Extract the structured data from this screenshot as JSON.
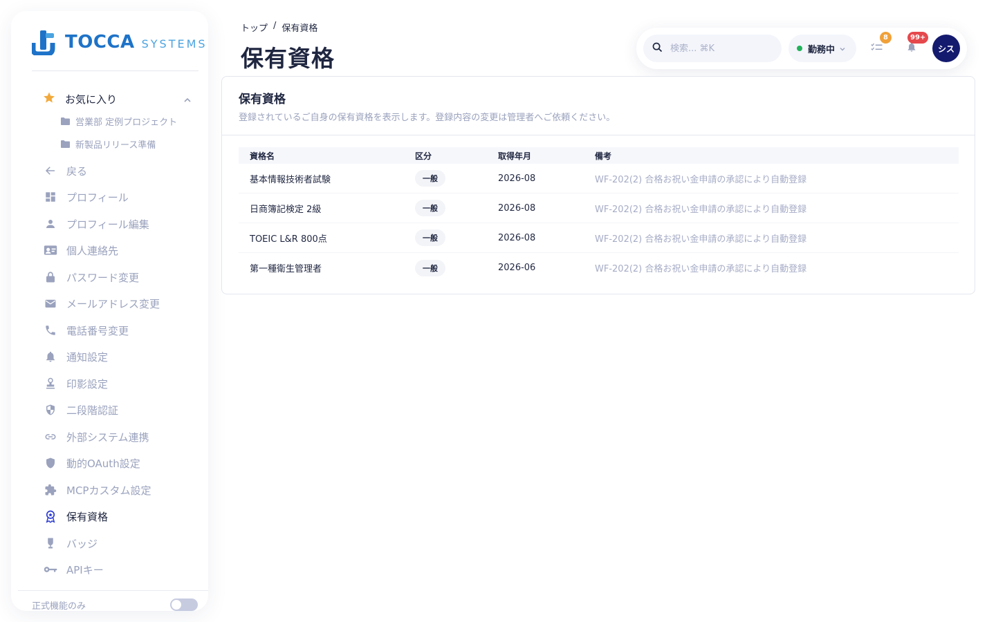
{
  "brand": {
    "name": "TOCCA",
    "suffix": "SYSTEMS"
  },
  "sidebar": {
    "favorites": {
      "label": "お気に入り",
      "items": [
        "営業部 定例プロジェクト",
        "新製品リリース準備"
      ]
    },
    "items": [
      {
        "label": "戻る",
        "icon": "arrow-left-icon"
      },
      {
        "label": "プロフィール",
        "icon": "dashboard-icon"
      },
      {
        "label": "プロフィール編集",
        "icon": "person-icon"
      },
      {
        "label": "個人連絡先",
        "icon": "contact-card-icon"
      },
      {
        "label": "パスワード変更",
        "icon": "lock-icon"
      },
      {
        "label": "メールアドレス変更",
        "icon": "mail-icon"
      },
      {
        "label": "電話番号変更",
        "icon": "phone-icon"
      },
      {
        "label": "通知設定",
        "icon": "bell-icon"
      },
      {
        "label": "印影設定",
        "icon": "stamp-icon"
      },
      {
        "label": "二段階認証",
        "icon": "shield-half-icon"
      },
      {
        "label": "外部システム連携",
        "icon": "link-icon"
      },
      {
        "label": "動的OAuth設定",
        "icon": "shield-icon"
      },
      {
        "label": "MCPカスタム設定",
        "icon": "puzzle-icon"
      },
      {
        "label": "保有資格",
        "icon": "award-icon",
        "active": true
      },
      {
        "label": "バッジ",
        "icon": "badge-icon"
      },
      {
        "label": "APIキー",
        "icon": "key-icon"
      }
    ],
    "official_only": "正式機能のみ"
  },
  "breadcrumb": {
    "home": "トップ",
    "separator": "/",
    "current": "保有資格"
  },
  "page_title": "保有資格",
  "topbar": {
    "search_placeholder": "検索... ⌘K",
    "status": "勤務中",
    "tasks_count": "8",
    "notifications_count": "99+",
    "avatar": "シス"
  },
  "card": {
    "title": "保有資格",
    "description": "登録されているご自身の保有資格を表示します。登録内容の変更は管理者へご依頼ください。",
    "columns": [
      "資格名",
      "区分",
      "取得年月",
      "備考"
    ],
    "rows": [
      {
        "name": "基本情報技術者試験",
        "category": "一般",
        "date": "2026-08",
        "note": "WF-202(2) 合格お祝い金申請の承認により自動登録"
      },
      {
        "name": "日商簿記検定 2級",
        "category": "一般",
        "date": "2026-08",
        "note": "WF-202(2) 合格お祝い金申請の承認により自動登録"
      },
      {
        "name": "TOEIC L&R 800点",
        "category": "一般",
        "date": "2026-08",
        "note": "WF-202(2) 合格お祝い金申請の承認により自動登録"
      },
      {
        "name": "第一種衛生管理者",
        "category": "一般",
        "date": "2026-06",
        "note": "WF-202(2) 合格お祝い金申請の承認により自動登録"
      }
    ]
  },
  "colors": {
    "accent": "#1e73c8",
    "active_icon": "#2b3bd1",
    "avatar_bg": "#141a6e",
    "status_dot": "#22b25a",
    "tasks_badge": "#f0a13a",
    "notif_badge": "#e5484d",
    "muted": "#9aa2bd"
  }
}
